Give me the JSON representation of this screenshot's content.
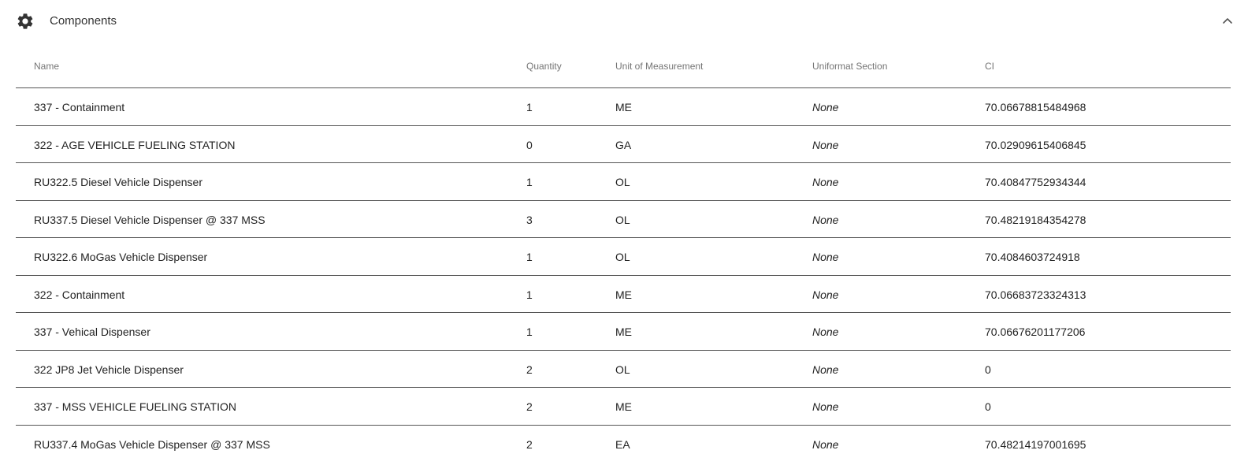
{
  "panel": {
    "title": "Components",
    "icon": "gear-icon",
    "collapse_icon": "chevron-up-icon"
  },
  "table": {
    "columns": [
      "Name",
      "Quantity",
      "Unit of Measurement",
      "Uniformat Section",
      "CI"
    ],
    "rows": [
      {
        "name": "337 - Containment",
        "quantity": "1",
        "unit": "ME",
        "uniformat": "None",
        "ci": "70.06678815484968"
      },
      {
        "name": "322 - AGE VEHICLE FUELING STATION",
        "quantity": "0",
        "unit": "GA",
        "uniformat": "None",
        "ci": "70.02909615406845"
      },
      {
        "name": "RU322.5 Diesel Vehicle Dispenser",
        "quantity": "1",
        "unit": "OL",
        "uniformat": "None",
        "ci": "70.40847752934344"
      },
      {
        "name": "RU337.5 Diesel Vehicle Dispenser @ 337 MSS",
        "quantity": "3",
        "unit": "OL",
        "uniformat": "None",
        "ci": "70.48219184354278"
      },
      {
        "name": "RU322.6 MoGas Vehicle Dispenser",
        "quantity": "1",
        "unit": "OL",
        "uniformat": "None",
        "ci": "70.4084603724918"
      },
      {
        "name": "322 - Containment",
        "quantity": "1",
        "unit": "ME",
        "uniformat": "None",
        "ci": "70.06683723324313"
      },
      {
        "name": "337 - Vehical Dispenser",
        "quantity": "1",
        "unit": "ME",
        "uniformat": "None",
        "ci": "70.06676201177206"
      },
      {
        "name": "322 JP8 Jet Vehicle Dispenser",
        "quantity": "2",
        "unit": "OL",
        "uniformat": "None",
        "ci": "0"
      },
      {
        "name": "337 - MSS VEHICLE FUELING STATION",
        "quantity": "2",
        "unit": "ME",
        "uniformat": "None",
        "ci": "0"
      },
      {
        "name": "RU337.4 MoGas Vehicle Dispenser @ 337 MSS",
        "quantity": "2",
        "unit": "EA",
        "uniformat": "None",
        "ci": "70.48214197001695"
      }
    ]
  }
}
